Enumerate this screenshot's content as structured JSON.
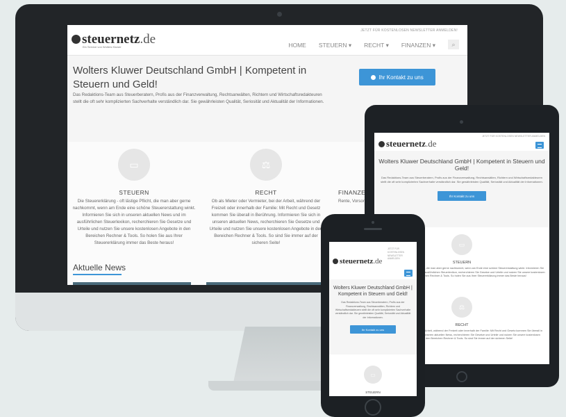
{
  "site": {
    "logo_name": "steuernetz",
    "logo_tld": ".de",
    "logo_sub": "Ein Service von Wolters Kluwer",
    "topbar_text": "JETZT FÜR KOSTENLOSEN NEWSLETTER ANMELDEN!",
    "nav": {
      "home": "HOME",
      "steuern": "STEUERN ▾",
      "recht": "RECHT ▾",
      "finanzen": "FINANZEN ▾",
      "search_icon": "⌕"
    },
    "hero": {
      "title": "Wolters Kluwer Deutschland GmbH | Kompetent in Steuern und Geld!",
      "text": "Das Redaktions-Team aus Steuerberatern, Profis aus der Finanzverwaltung, Rechtsanwälten, Richtern und Wirtschaftsredakteuren stellt die oft sehr komplizierten Sachverhalte verständlich dar. Sie gewährleisten Qualität, Seriosität und Aktualität der Informationen.",
      "cta": "Ihr Kontakt zu uns"
    },
    "features": [
      {
        "title": "STEUERN",
        "icon": "▭",
        "text": "Die Steuererklärung - oft lästige Pflicht, die man aber gerne nachkommt, wenn am Ende eine schöne Steuererstattung winkt. Informieren Sie sich in unseren aktuellen News und im ausführlichen Steuerlexikon, recherchieren Sie Gesetze und Urteile und nutzen Sie unsere kostenlosen Angebote in den Bereichen Rechner & Tools. So holen Sie aus Ihrer Steuererklärung immer das Beste heraus!"
      },
      {
        "title": "RECHT",
        "icon": "⚖",
        "text": "Ob als Mieter oder Vermieter, bei der Arbeit, während der Freizeit oder innerhalb der Familie: Mit Recht und Gesetz kommen Sie überall in Berührung. Informieren Sie sich in unseren aktuellen News, recherchieren Sie Gesetze und Urteile und nutzen Sie unsere kostenlosen Angebote in den Bereichen Rechner & Tools. So sind Sie immer auf der sicheren Seite!"
      },
      {
        "title": "FINANZEN",
        "icon": "€",
        "text": "Rente, Vorsorge und ..."
      }
    ],
    "news_title": "Aktuelle News"
  },
  "tablet": {
    "topbar_text": "JETZT FÜR KOSTENLOSEN NEWSLETTER ANMELDEN",
    "hero_title": "Wolters Kluwer Deutschland GmbH | Kompetent in Steuern und Geld!",
    "hero_text": "Das Redaktions-Team aus Steuerberatern, Profis aus der Finanzverwaltung, Rechtsanwälten, Richtern und Wirtschaftsredakteuren stellt die oft sehr komplizierten Sachverhalte verständlich dar. Sie gewährleisten Qualität, Seriosität und Aktualität der Informationen.",
    "cta": "Ihr Kontakt zu uns",
    "feature1_title": "STEUERN",
    "feature1_text": "Die Steuererklärung - oft lästige Pflicht, die man aber gerne nachkommt, wenn am Ende eine schöne Steuererstattung winkt. Informieren Sie sich in unseren aktuellen News und im ausführlichen Steuerlexikon, recherchieren Sie Gesetze und Urteile und nutzen Sie unsere kostenlosen Angebote in den Bereichen Rechner & Tools. So holen Sie aus Ihrer Steuererklärung immer das Beste heraus!",
    "feature2_title": "RECHT",
    "feature2_text": "Ob als Mieter oder Vermieter, bei der Arbeit, während der Freizeit oder innerhalb der Familie: Mit Recht und Gesetz kommen Sie überall in Berührung. Informieren Sie sich in unseren aktuellen News, recherchieren Sie Gesetze und Urteile und nutzen Sie unsere kostenlosen Angebote in den Bereichen Rechner & Tools. So sind Sie immer auf der sicheren Seite!"
  },
  "phone": {
    "topbar_text": "JETZT FÜR KOSTENLOSEN NEWSLETTER ANMELDEN",
    "hero_title": "Wolters Kluwer Deutschland GmbH | Kompetent in Steuern und Geld!",
    "hero_text": "Das Redaktions-Team aus Steuerberatern, Profis aus der Finanzverwaltung, Rechtsanwälten, Richtern und Wirtschaftsredakteuren stellt die oft sehr komplizierten Sachverhalte verständlich dar. Sie gewährleisten Qualität, Seriosität und Aktualität der Informationen.",
    "cta": "Ihr Kontakt zu uns",
    "feature1_title": "STEUERN"
  },
  "colors": {
    "accent": "#3d95d7",
    "device_frame": "#1d2125",
    "background": "#e6ecec"
  }
}
